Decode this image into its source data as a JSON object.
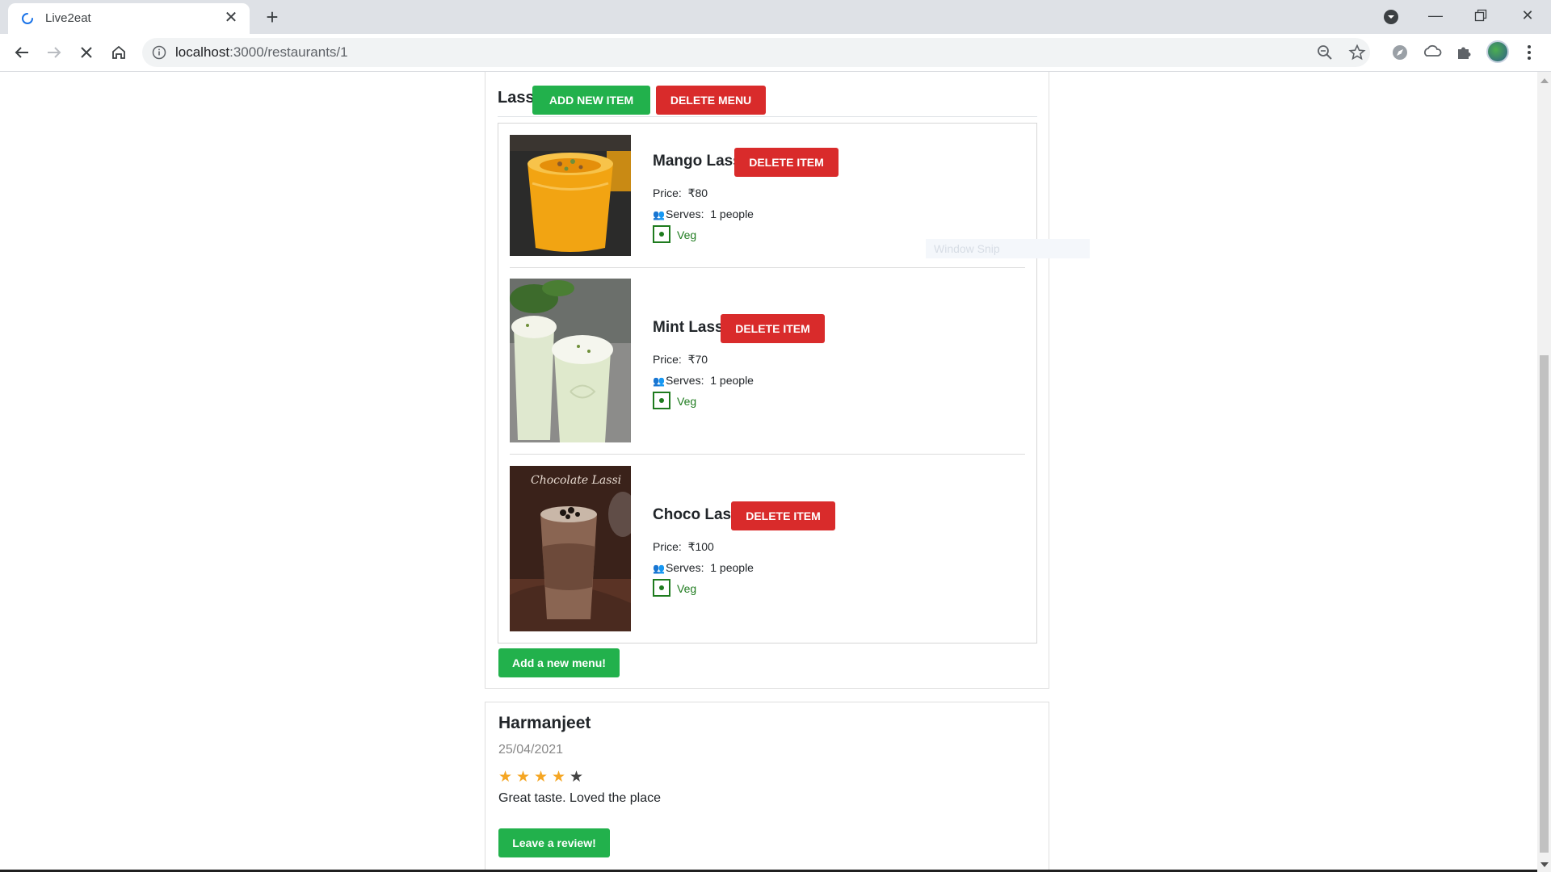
{
  "browser": {
    "tab_title": "Live2eat",
    "url_host": "localhost",
    "url_path": ":3000/restaurants/1"
  },
  "menu": {
    "name": "Lassi",
    "add_item_label": "ADD NEW ITEM",
    "delete_menu_label": "DELETE MENU",
    "items": [
      {
        "name": "Mango Lassi",
        "price_label": "Price:",
        "price": "₹80",
        "serves_label": "Serves:",
        "serves": "1 people",
        "diet": "Veg",
        "delete_label": "DELETE ITEM"
      },
      {
        "name": "Mint Lassi",
        "price_label": "Price:",
        "price": "₹70",
        "serves_label": "Serves:",
        "serves": "1 people",
        "diet": "Veg",
        "delete_label": "DELETE ITEM"
      },
      {
        "name": "Choco Lassi",
        "price_label": "Price:",
        "price": "₹100",
        "serves_label": "Serves:",
        "serves": "1 people",
        "diet": "Veg",
        "delete_label": "DELETE ITEM"
      }
    ],
    "choco_image_caption": "Chocolate Lassi",
    "add_menu_label": "Add a new menu!"
  },
  "review": {
    "author": "Harmanjeet",
    "date": "25/04/2021",
    "rating": 4,
    "max_rating": 5,
    "text": "Great taste. Loved the place",
    "leave_review_label": "Leave a review!"
  },
  "overlay": {
    "ghost_text": "Window Snip"
  },
  "colors": {
    "green": "#22b14c",
    "red": "#d92b2b",
    "veg": "#1e7b1e",
    "star": "#f5a623"
  }
}
